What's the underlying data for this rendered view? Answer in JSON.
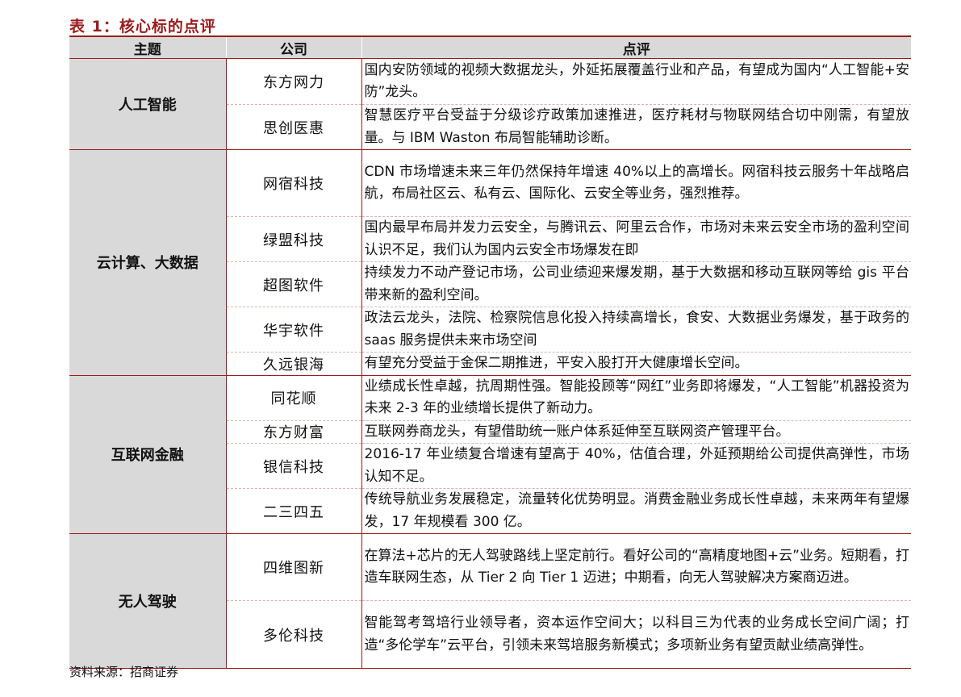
{
  "title": "表 1：核心标的点评",
  "table": {
    "headers": [
      "主题",
      "公司",
      "点评"
    ],
    "groups": [
      {
        "theme": "人工智能",
        "rows": [
          {
            "company": "东方网力",
            "comment": "国内安防领域的视频大数据龙头，外延拓展覆盖行业和产品，有望成为国内“人工智能+安防”龙头。"
          },
          {
            "company": "思创医惠",
            "comment": "智慧医疗平台受益于分级诊疗政策加速推进，医疗耗材与物联网结合切中刚需，有望放量。与 IBM Waston 布局智能辅助诊断。"
          }
        ]
      },
      {
        "theme": "云计算、大数据",
        "rows": [
          {
            "company": "网宿科技",
            "comment": "CDN 市场增速未来三年仍然保持年增速 40%以上的高增长。网宿科技云服务十年战略启航，布局社区云、私有云、国际化、云安全等业务，强烈推荐。"
          },
          {
            "company": "绿盟科技",
            "comment": "国内最早布局并发力云安全，与腾讯云、阿里云合作，市场对未来云安全市场的盈利空间认识不足，我们认为国内云安全市场爆发在即"
          },
          {
            "company": "超图软件",
            "comment": "持续发力不动产登记市场，公司业绩迎来爆发期，基于大数据和移动互联网等给 gis 平台带来新的盈利空间。"
          },
          {
            "company": "华宇软件",
            "comment": "政法云龙头，法院、检察院信息化投入持续高增长，食安、大数据业务爆发，基于政务的 saas 服务提供未来市场空间"
          },
          {
            "company": "久远银海",
            "comment": "有望充分受益于金保二期推进，平安入股打开大健康增长空间。"
          }
        ]
      },
      {
        "theme": "互联网金融",
        "rows": [
          {
            "company": "同花顺",
            "comment": "业绩成长性卓越，抗周期性强。智能投顾等“网红”业务即将爆发，“人工智能”机器投资为未来 2-3 年的业绩增长提供了新动力。"
          },
          {
            "company": "东方财富",
            "comment": "互联网券商龙头，有望借助统一账户体系延伸至互联网资产管理平台。"
          },
          {
            "company": "银信科技",
            "comment": "2016-17 年业绩复合增速有望高于 40%，估值合理，外延预期给公司提供高弹性，市场认知不足。"
          },
          {
            "company": "二三四五",
            "comment": "传统导航业务发展稳定，流量转化优势明显。消费金融业务成长性卓越，未来两年有望爆发，17 年规模看 300 亿。"
          }
        ]
      },
      {
        "theme": "无人驾驶",
        "rows": [
          {
            "company": "四维图新",
            "comment": "在算法+芯片的无人驾驶路线上坚定前行。看好公司的“高精度地图+云”业务。短期看，打造车联网生态，从 Tier 2 向 Tier 1 迈进；中期看，向无人驾驶解决方案商迈进。"
          },
          {
            "company": "多伦科技",
            "comment": "智能驾考驾培行业领导者，资本运作空间大；以科目三为代表的业务成长空间广阔；打造“多伦学车”云平台，引领未来驾培服务新模式；多项新业务有望贡献业绩高弹性。"
          }
        ]
      }
    ]
  },
  "source": "资料来源：招商证券"
}
